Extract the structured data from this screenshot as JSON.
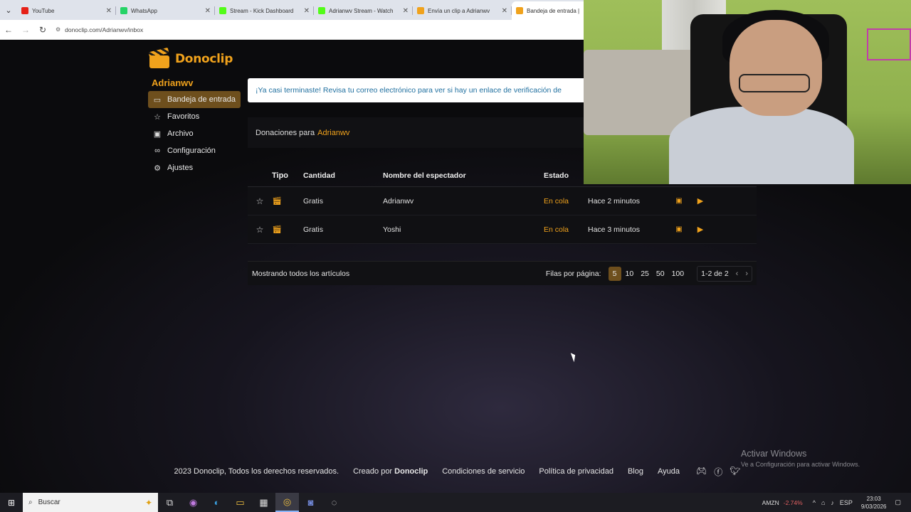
{
  "browser": {
    "tabs": [
      {
        "label": "YouTube",
        "color": "#e62117",
        "active": false
      },
      {
        "label": "WhatsApp",
        "color": "#25d366",
        "active": false
      },
      {
        "label": "Stream - Kick Dashboard",
        "color": "#53fc18",
        "active": false
      },
      {
        "label": "Adrianwv Stream - Watch",
        "color": "#53fc18",
        "active": false
      },
      {
        "label": "Envía un clip a Adrianwv",
        "color": "#f0a21c",
        "active": false
      },
      {
        "label": "Bandeja de entrada | ",
        "color": "#f0a21c",
        "active": true
      }
    ],
    "url": "donoclip.com/Adrianwv/inbox"
  },
  "brand": {
    "name": "Donoclip",
    "accent": "#f0a21c"
  },
  "user": {
    "name": "Adrianwv"
  },
  "sidebar": {
    "items": [
      {
        "label": "Bandeja de entrada",
        "icon": "inbox-icon",
        "active": true
      },
      {
        "label": "Favoritos",
        "icon": "star-icon",
        "active": false
      },
      {
        "label": "Archivo",
        "icon": "archive-icon",
        "active": false
      },
      {
        "label": "Configuración",
        "icon": "link-icon",
        "active": false
      },
      {
        "label": "Ajustes",
        "icon": "gear-icon",
        "active": false
      }
    ]
  },
  "alert": {
    "text": "¡Ya casi terminaste! Revisa tu correo electrónico para ver si hay un enlace de verificación de"
  },
  "donations": {
    "header_prefix": "Donaciones para",
    "header_user": "Adrianwv",
    "columns": [
      "Tipo",
      "Cantidad",
      "Nombre del espectador",
      "Estado"
    ],
    "rows": [
      {
        "amount": "Gratis",
        "name": "Adrianwv",
        "status": "En cola",
        "time": "Hace 2 minutos"
      },
      {
        "amount": "Gratis",
        "name": "Yoshi",
        "status": "En cola",
        "time": "Hace 3 minutos"
      }
    ]
  },
  "pager": {
    "showing": "Mostrando todos los artículos",
    "rows_label": "Filas por página:",
    "options": [
      "5",
      "10",
      "25",
      "50",
      "100"
    ],
    "selected": "5",
    "range": "1-2 de 2"
  },
  "footer": {
    "copyright": "2023 Donoclip, Todos los derechos reservados.",
    "created_prefix": "Creado por",
    "created_brand": "Donoclip",
    "terms": "Condiciones de servicio",
    "privacy": "Política de privacidad",
    "blog": "Blog",
    "help": "Ayuda"
  },
  "watermark": {
    "line1": "Activar Windows",
    "line2": "Ve a Configuración para activar Windows."
  },
  "taskbar": {
    "search_placeholder": "Buscar",
    "stock_symbol": "AMZN",
    "stock_change": "-2.74%",
    "lang": "ESP",
    "time": "23:03",
    "date": "9/03/2026"
  }
}
